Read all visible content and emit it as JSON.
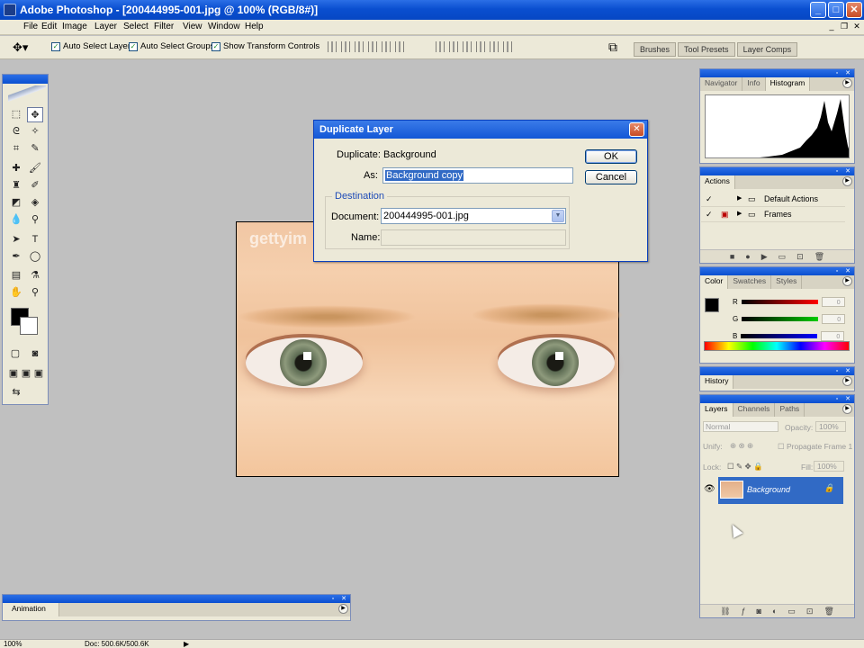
{
  "window": {
    "title": "Adobe Photoshop - [200444995-001.jpg @ 100% (RGB/8#)]"
  },
  "menu": [
    "File",
    "Edit",
    "Image",
    "Layer",
    "Select",
    "Filter",
    "View",
    "Window",
    "Help"
  ],
  "options": {
    "auto_select_layer": "Auto Select Layer",
    "auto_select_groups": "Auto Select Groups",
    "show_transform": "Show Transform Controls"
  },
  "palette_well": [
    "Brushes",
    "Tool Presets",
    "Layer Comps"
  ],
  "document": {
    "watermark": "gettyim"
  },
  "dialog": {
    "title": "Duplicate Layer",
    "duplicate_label": "Duplicate:",
    "duplicate_value": "Background",
    "as_label": "As:",
    "as_value": "Background copy",
    "destination_label": "Destination",
    "document_label": "Document:",
    "document_value": "200444995-001.jpg",
    "name_label": "Name:",
    "ok": "OK",
    "cancel": "Cancel"
  },
  "nav_panel": {
    "tabs": [
      "Navigator",
      "Info",
      "Histogram"
    ],
    "active": "Histogram"
  },
  "actions_panel": {
    "tab": "Actions",
    "items": [
      "Default Actions",
      "Frames"
    ]
  },
  "color_panel": {
    "tabs": [
      "Color",
      "Swatches",
      "Styles"
    ],
    "channels": [
      {
        "label": "R",
        "value": "0",
        "color": "#e00000"
      },
      {
        "label": "G",
        "value": "0",
        "color": "#00b000"
      },
      {
        "label": "B",
        "value": "0",
        "color": "#0000e0"
      }
    ]
  },
  "history_panel": {
    "tab": "History"
  },
  "layers_panel": {
    "tabs": [
      "Layers",
      "Channels",
      "Paths"
    ],
    "blend": "Normal",
    "opacity_label": "Opacity:",
    "opacity": "100%",
    "unify": "Unify:",
    "propagate": "Propagate Frame 1",
    "lock": "Lock:",
    "fill_label": "Fill:",
    "fill": "100%",
    "layer_name": "Background"
  },
  "animation_panel": {
    "tab": "Animation"
  },
  "status": {
    "zoom": "100%",
    "doc": "Doc: 500.6K/500.6K"
  }
}
